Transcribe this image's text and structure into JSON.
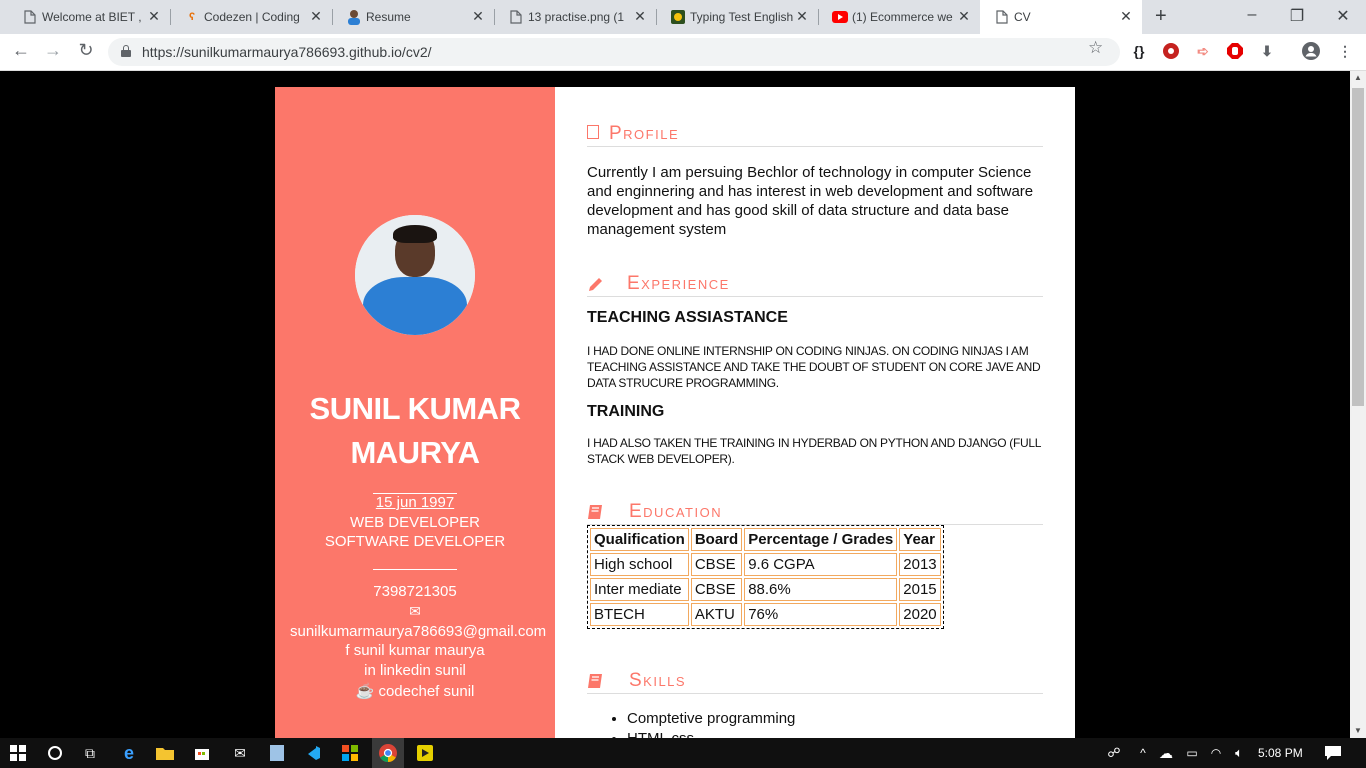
{
  "browser": {
    "tabs": [
      {
        "title": "Welcome at BIET ,",
        "favicon": "doc-icon"
      },
      {
        "title": "Codezen | Coding",
        "favicon": "codezen-icon"
      },
      {
        "title": "Resume",
        "favicon": "avatar-icon"
      },
      {
        "title": "13 practise.png (1",
        "favicon": "doc-icon"
      },
      {
        "title": "Typing Test English",
        "favicon": "typing-icon"
      },
      {
        "title": "(1) Ecommerce we",
        "favicon": "youtube-icon"
      },
      {
        "title": "CV",
        "favicon": "doc-icon"
      }
    ],
    "active_tab": 6,
    "url": "https://sunilkumarmaurya786693.github.io/cv2/",
    "accent_color": "#fc776a"
  },
  "cv": {
    "name": "SUNIL KUMAR MAURYA",
    "dob": "15 jun 1997",
    "roles": [
      "WEB DEVELOPER",
      "SOFTWARE DEVELOPER"
    ],
    "phone": "7398721305",
    "email": "sunilkumarmaurya786693@gmail.com",
    "links": [
      {
        "label": "sunil kumar maurya",
        "icon": "facebook-icon"
      },
      {
        "label": "linkedin sunil",
        "icon": "linkedin-icon"
      },
      {
        "label": "codechef sunil",
        "icon": "codechef-icon"
      }
    ],
    "sections": {
      "profile": "Profile",
      "experience": "Experience",
      "education": "Education",
      "skills": "Skills"
    },
    "profile_text": "Currently I am persuing Bechlor of technology in computer Science and enginnering and has interest in web development and software development and has good skill of data structure and data base management system",
    "experience": [
      {
        "title": "TEACHING ASSIASTANCE",
        "desc": "I HAD DONE ONLINE INTERNSHIP ON CODING NINJAS. ON CODING NINJAS I AM TEACHING ASSISTANCE AND TAKE THE DOUBT OF STUDENT ON CORE JAVE AND DATA STRUCURE PROGRAMMING."
      },
      {
        "title": "TRAINING",
        "desc": "I HAD ALSO TAKEN THE TRAINING IN HYDERBAD ON PYTHON AND DJANGO (FULL STACK WEB DEVELOPER)."
      }
    ],
    "education": {
      "headers": [
        "Qualification",
        "Board",
        "Percentage / Grades",
        "Year"
      ],
      "rows": [
        [
          "High school",
          "CBSE",
          "9.6 CGPA",
          "2013"
        ],
        [
          "Inter mediate",
          "CBSE",
          "88.6%",
          "2015"
        ],
        [
          "BTECH",
          "AKTU",
          "76%",
          "2020"
        ]
      ]
    },
    "skills": [
      "Comptetive programming",
      "HTML css"
    ]
  },
  "taskbar": {
    "time": "5:08 PM"
  }
}
